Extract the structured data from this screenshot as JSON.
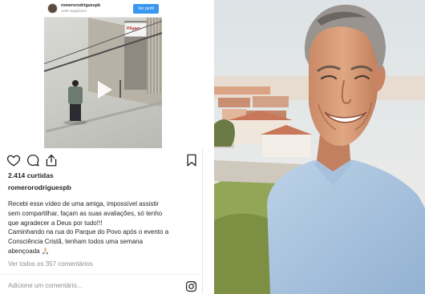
{
  "embedded_post": {
    "username": "romerorodriguespb",
    "followers": "118K seguidores",
    "follow_label": "Ver perfil",
    "sign_text": "PAgam"
  },
  "post": {
    "likes": "2.414 curtidas",
    "author": "romerorodriguespb",
    "caption_lines": [
      "Recebi esse vídeo de uma amiga, impossível assistir",
      "sem compartilhar, façam as suas avaliações, só tenho",
      "que agradecer a Deus por tudo!!!",
      "Caminhando na rua do Parque do Povo após o evento a",
      "Consciência Cristã, tenham todos uma semana",
      "abençoada 🙏🏻"
    ],
    "view_all": "Ver todos os 357 comentários",
    "comment_placeholder": "Adicione um comentário..."
  },
  "icons": {
    "like": "heart-icon",
    "comment": "comment-icon",
    "share": "share-icon",
    "save": "bookmark-icon",
    "play": "play-icon",
    "instagram": "instagram-icon"
  },
  "colors": {
    "follow_button": "#3897f0",
    "text": "#262626",
    "muted": "#8e8e8e",
    "sky": "#e9edf0",
    "shirt": "#a9c3df"
  }
}
